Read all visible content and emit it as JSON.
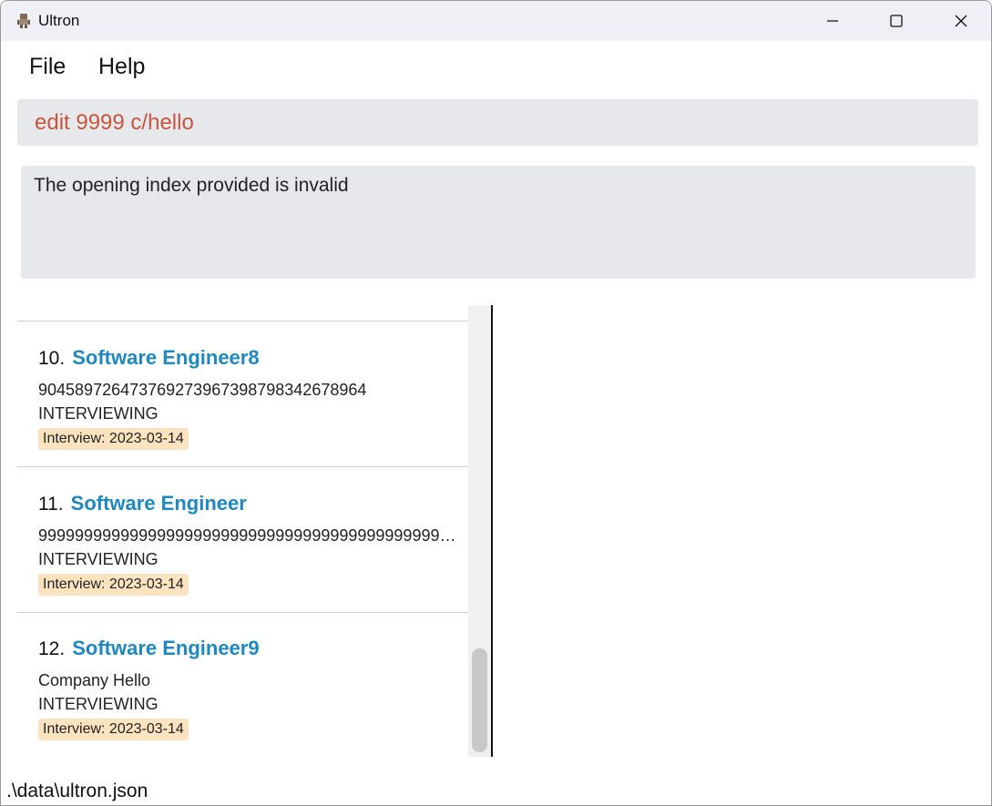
{
  "window": {
    "title": "Ultron",
    "app_icon": "robot-icon",
    "controls": [
      "minimize-icon",
      "maximize-icon",
      "close-icon"
    ]
  },
  "menu": {
    "file": "File",
    "help": "Help"
  },
  "command_box": {
    "value": "edit 9999 c/hello",
    "color": "#c8553d"
  },
  "result_box": {
    "message": "The opening index provided is invalid"
  },
  "openings": [
    {
      "index": "10.",
      "title": "Software Engineer8",
      "company": "90458972647376927396739879834267896​4",
      "status": "INTERVIEWING",
      "tag": "Interview: 2023-03-14"
    },
    {
      "index": "11.",
      "title": "Software Engineer",
      "company": "9999999999999999999999999999999999999999999999999...",
      "status": "INTERVIEWING",
      "tag": "Interview: 2023-03-14"
    },
    {
      "index": "12.",
      "title": "Software Engineer9",
      "company": "Company Hello",
      "status": "INTERVIEWING",
      "tag": "Interview: 2023-03-14"
    }
  ],
  "status_bar": {
    "path": ".\\data\\ultron.json"
  },
  "colors": {
    "accent_title": "#1e88bf",
    "tag_background": "#fce3c0",
    "panel_background": "#e6e8ec"
  }
}
